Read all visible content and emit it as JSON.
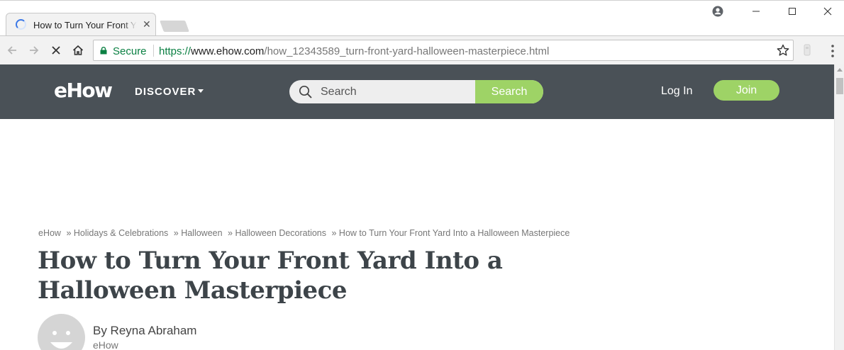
{
  "browser": {
    "tab_title": "How to Turn Your Front Yard Into a Halloween Masterpiece",
    "tab_close": "✕",
    "secure_label": "Secure",
    "url_scheme": "https://",
    "url_host": "www.ehow.com",
    "url_path": "/how_12343589_turn-front-yard-halloween-masterpiece.html"
  },
  "site": {
    "logo": "eHow",
    "discover": "DISCOVER",
    "search_placeholder": "Search",
    "search_button": "Search",
    "login": "Log In",
    "join": "Join",
    "colors": {
      "header_bg": "#4a5157",
      "accent_green": "#9ed366"
    }
  },
  "article": {
    "breadcrumb": [
      "eHow",
      "» Holidays & Celebrations",
      "» Halloween",
      "» Halloween Decorations",
      "» How to Turn Your Front Yard Into a Halloween Masterpiece"
    ],
    "title": "How to Turn Your Front Yard Into a Halloween Masterpiece",
    "author": "By Reyna Abraham",
    "author_org": "eHow"
  }
}
